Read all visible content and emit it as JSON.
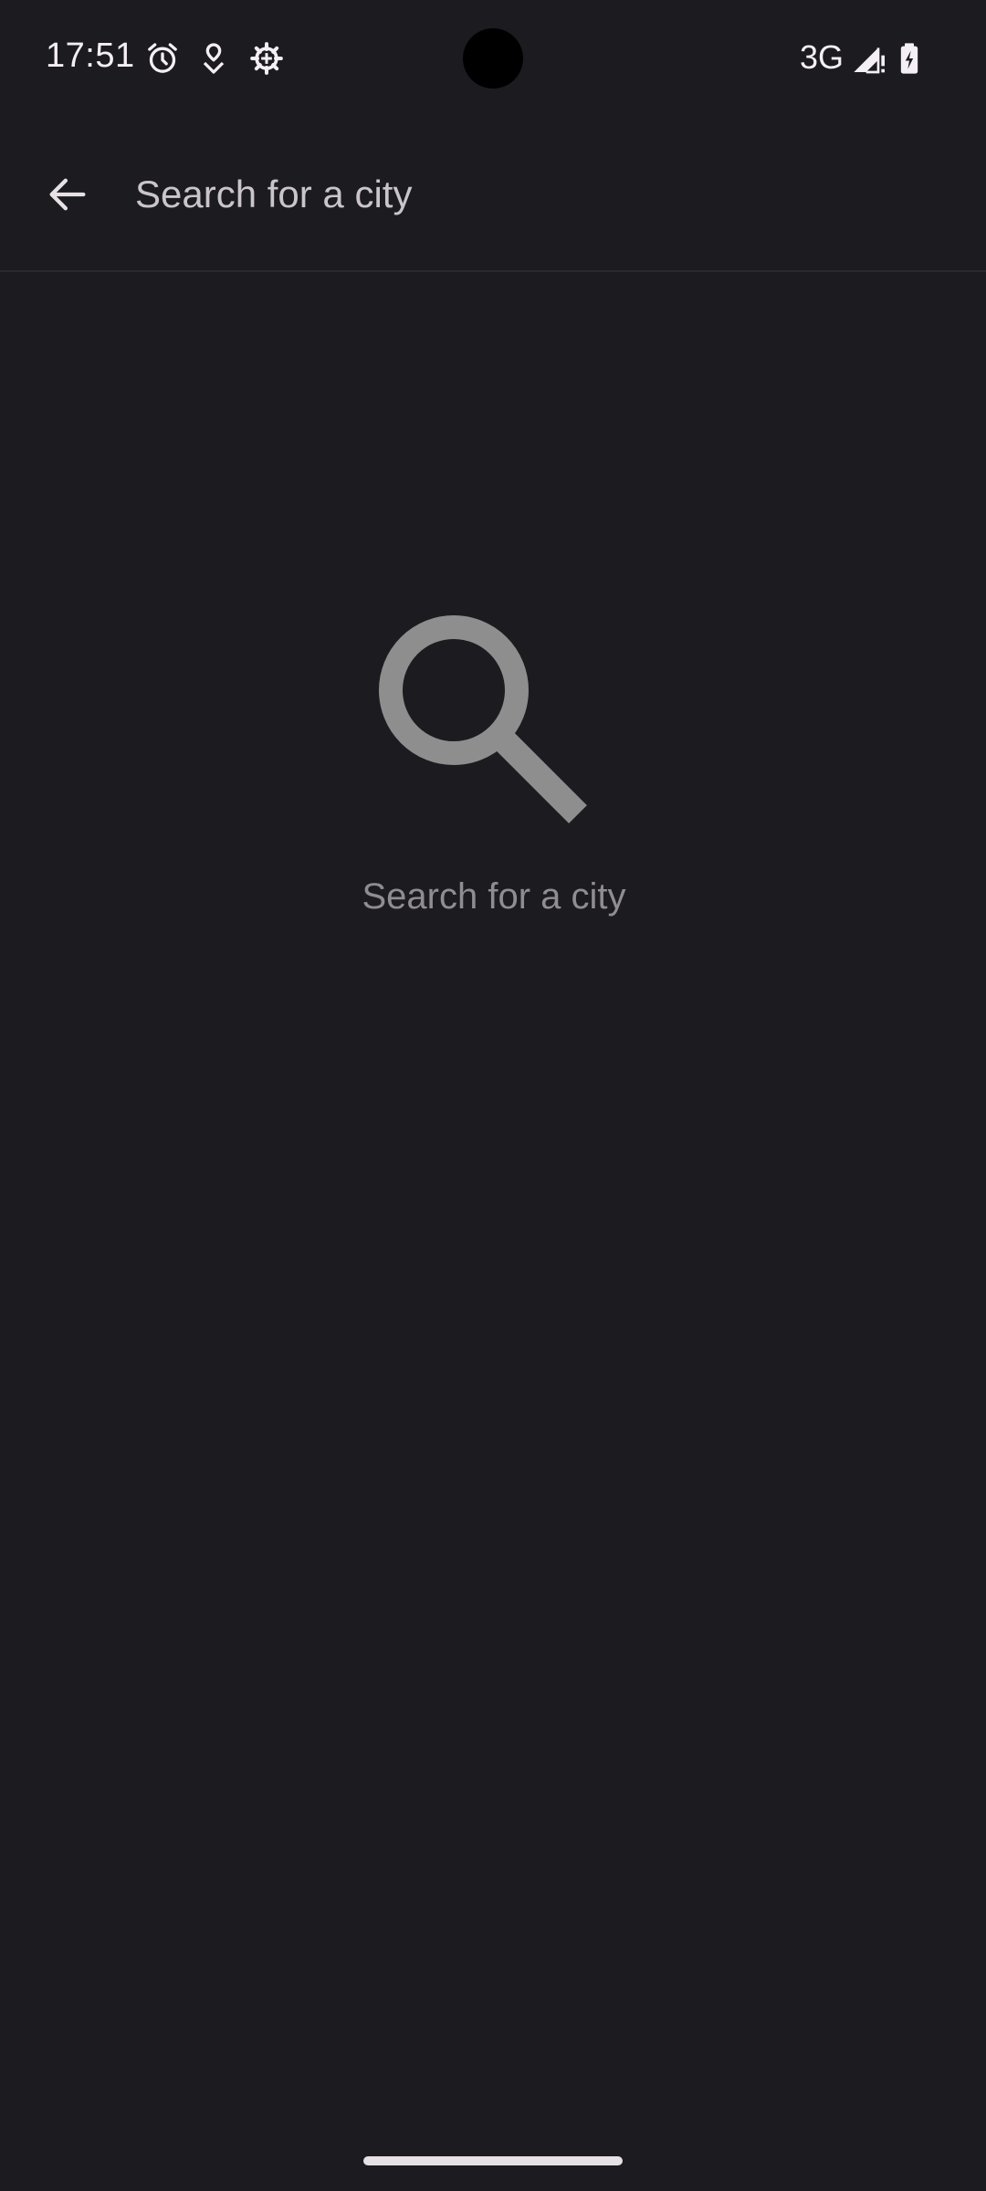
{
  "status_bar": {
    "time": "17:51",
    "network": "3G",
    "icons": [
      "alarm-icon",
      "location-drop-icon",
      "settings-gear-icon",
      "signal-icon",
      "battery-charging-icon"
    ]
  },
  "search": {
    "placeholder": "Search for a city",
    "value": ""
  },
  "empty_state": {
    "icon": "search-icon",
    "message": "Search for a city"
  },
  "colors": {
    "background": "#1c1b1f",
    "text": "#e6e1e5",
    "muted": "#8f8d92"
  }
}
